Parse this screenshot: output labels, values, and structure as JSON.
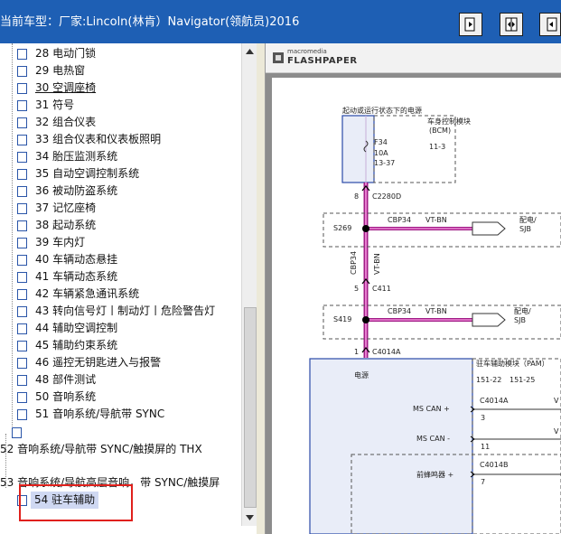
{
  "window": {
    "title": "当前车型：厂家:Lincoln(林肯）Navigator(领航员)2016"
  },
  "toolbar": {
    "btn1_icon": "page-forward-icon",
    "btn2_icon": "fit-width-icon",
    "btn3_icon": "page-back-icon"
  },
  "tree": {
    "items": [
      {
        "label": "28 电动门锁"
      },
      {
        "label": "29 电热窗"
      },
      {
        "label": "30 空调座椅"
      },
      {
        "label": "31 符号"
      },
      {
        "label": "32 组合仪表"
      },
      {
        "label": "33 组合仪表和仪表板照明"
      },
      {
        "label": "34 胎压监测系统"
      },
      {
        "label": "35 自动空调控制系统"
      },
      {
        "label": "36 被动防盗系统"
      },
      {
        "label": "37 记忆座椅"
      },
      {
        "label": "38 起动系统"
      },
      {
        "label": "39 车内灯"
      },
      {
        "label": "40 车辆动态悬挂"
      },
      {
        "label": "41 车辆动态系统"
      },
      {
        "label": "42 车辆紧急通讯系统"
      },
      {
        "label": "43 转向信号灯丨制动灯丨危险警告灯"
      },
      {
        "label": "44 辅助空调控制"
      },
      {
        "label": "45 辅助约束系统"
      },
      {
        "label": "46 遥控无钥匙进入与报警"
      },
      {
        "label": "48 部件测试"
      },
      {
        "label": "50 音响系统"
      },
      {
        "label": "51 音响系统/导航带 SYNC"
      }
    ],
    "folder52": "52 音响系统/导航带 SYNC/触摸屏的 THX",
    "folder53": "53 音响系统/导航高层音响，带 SYNC/触摸屏",
    "selected": "54 驻车辅助"
  },
  "viewer": {
    "brand_small": "macromedia",
    "brand_big": "FLASHPAPER"
  },
  "diagram": {
    "top_label": "起动或运行状态下的电源",
    "bcm_title": "车身控制模块",
    "bcm_abbr": "(BCM)",
    "fuse_name": "F34",
    "fuse_amp": "10A",
    "fuse_ref": "13-37",
    "bcm_page": "11-3",
    "conn1_pin": "8",
    "conn1_name": "C2280D",
    "splice1": "S269",
    "wire_a": "CBP34",
    "color_a": "VT-BN",
    "dist1": "配电/",
    "dist1b": "SJB",
    "vwire": "CBP34",
    "vcolor": "VT-BN",
    "conn2_pin": "5",
    "conn2_name": "C411",
    "splice2": "S419",
    "wire_b": "CBP34",
    "color_b": "VT-BN",
    "dist2": "配电/",
    "dist2b": "SJB",
    "conn3_pin": "1",
    "conn3_name": "C4014A",
    "power": "电源",
    "pam_title": "驻车辅助模块（PAM）",
    "pam_page1": "151-22",
    "pam_page2": "151-25",
    "can_plus": "MS CAN +",
    "can_minus": "MS CAN -",
    "conn4": "C4014A",
    "pin3": "3",
    "pin11": "11",
    "buzzer": "前蜂鸣器 +",
    "conn5": "C4014B",
    "pin7": "7",
    "v1": "V",
    "v2": "V"
  }
}
